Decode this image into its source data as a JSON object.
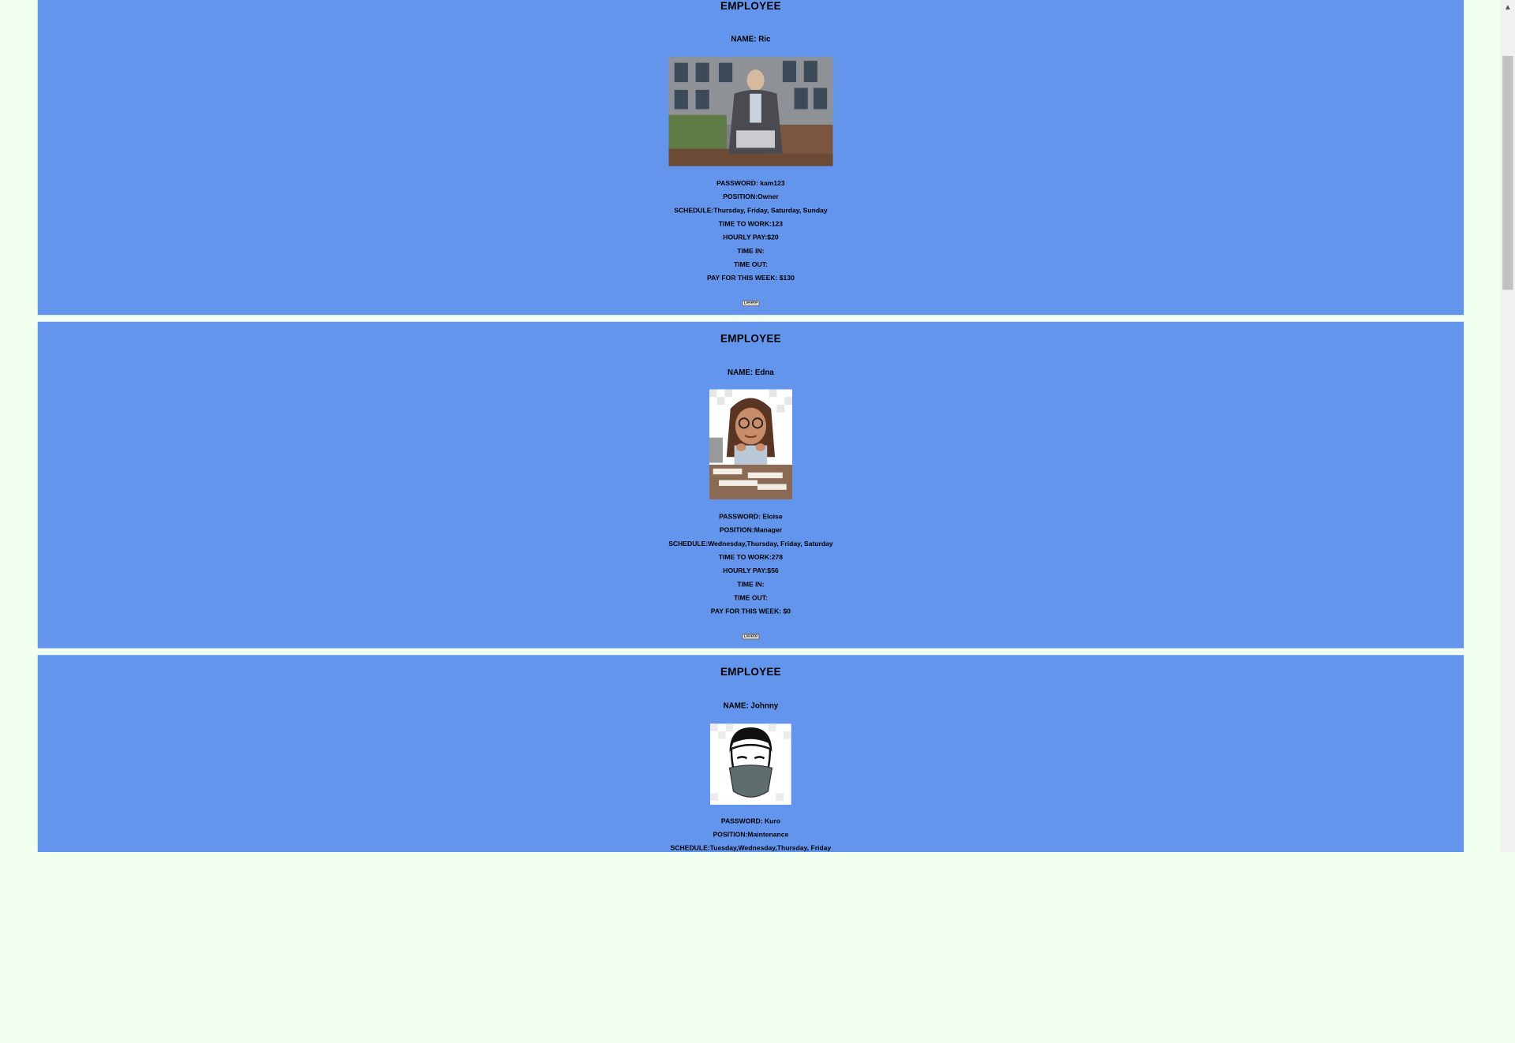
{
  "employees": [
    {
      "heading": "EMPLOYEE",
      "name": "NAME: Ric",
      "photo_desc": "man-on-bench-with-laptop",
      "password": "PASSWORD: kam123",
      "position": "POSITION:Owner",
      "schedule": "SCHEDULE:Thursday, Friday, Saturday, Sunday",
      "time_to_work": "TIME TO WORK:123",
      "hourly_pay": "HOURLY PAY:$20",
      "time_in": "TIME IN:",
      "time_out": "TIME OUT:",
      "pay_week": "PAY FOR THIS WEEK: $130",
      "delete_label": "Delete"
    },
    {
      "heading": "EMPLOYEE",
      "name": "NAME: Edna",
      "photo_desc": "cartoon-woman-at-desk",
      "password": "PASSWORD: Eloise",
      "position": "POSITION:Manager",
      "schedule": "SCHEDULE:Wednesday,Thursday, Friday, Saturday",
      "time_to_work": "TIME TO WORK:278",
      "hourly_pay": "HOURLY PAY:$56",
      "time_in": "TIME IN:",
      "time_out": "TIME OUT:",
      "pay_week": "PAY FOR THIS WEEK: $0",
      "delete_label": "Delete"
    },
    {
      "heading": "EMPLOYEE",
      "name": "NAME: Johnny",
      "photo_desc": "masked-man-avatar",
      "password": "PASSWORD: Kuro",
      "position": "POSITION:Maintenance",
      "schedule": "SCHEDULE:Tuesday,Wednesday,Thursday, Friday"
    }
  ],
  "icons": {
    "scroll_up": "scroll-up-arrow-icon"
  },
  "colors": {
    "card_bg": "#6495ed",
    "page_bg": "#f0fff0"
  }
}
